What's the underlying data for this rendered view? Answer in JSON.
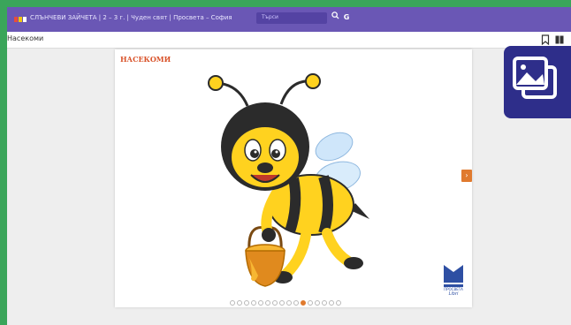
{
  "header": {
    "title": "СЛЪНЧЕВИ ЗАЙЧЕТА | 2 – 3 г. | Чуден свят | Просвета – София",
    "search_placeholder": "Търси",
    "search_icon": "search-icon",
    "g_label": "G"
  },
  "subheader": {
    "title": "Насекоми",
    "bookmark_icon": "bookmark-icon",
    "view_icon": "columns-icon"
  },
  "slide": {
    "title": "НАСЕКОМИ",
    "prev_arrow": "‹",
    "next_arrow": "›",
    "publisher_line1": "ПРОСВЕТА",
    "publisher_line2": "Libri"
  },
  "gallery_button": {
    "icon": "images-icon"
  },
  "pagination": {
    "total": 16,
    "current": 11
  },
  "colors": {
    "page_border": "#3aa55a",
    "topbar": "#6a57b5",
    "accent": "#e07a2e",
    "gallery": "#2e2e8a"
  }
}
